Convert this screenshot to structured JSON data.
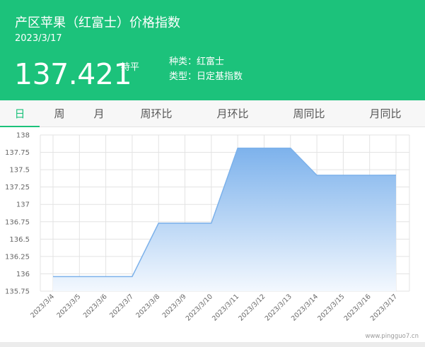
{
  "header": {
    "title": "产区苹果（红富士）价格指数",
    "date": "2023/3/17",
    "price": "137.421",
    "trend": "持平",
    "variety": "种类：红富士",
    "type": "类型：日定基指数"
  },
  "tabs": [
    {
      "label": "日",
      "active": true
    },
    {
      "label": "周",
      "active": false
    },
    {
      "label": "月",
      "active": false
    },
    {
      "label": "周环比",
      "active": false
    },
    {
      "label": "月环比",
      "active": false
    },
    {
      "label": "周同比",
      "active": false
    },
    {
      "label": "月同比",
      "active": false
    }
  ],
  "chart_data": {
    "type": "area",
    "categories": [
      "2023/3/4",
      "2023/3/5",
      "2023/3/6",
      "2023/3/7",
      "2023/3/8",
      "2023/3/9",
      "2023/3/10",
      "2023/3/11",
      "2023/3/12",
      "2023/3/13",
      "2023/3/14",
      "2023/3/15",
      "2023/3/16",
      "2023/3/17"
    ],
    "values": [
      135.96,
      135.96,
      135.96,
      135.96,
      136.73,
      136.73,
      136.73,
      137.81,
      137.81,
      137.81,
      137.42,
      137.42,
      137.42,
      137.421
    ],
    "yticks": [
      "138",
      "137.75",
      "137.5",
      "137.25",
      "137",
      "136.75",
      "136.5",
      "136.25",
      "136",
      "135.75"
    ],
    "ylim": [
      135.75,
      138
    ],
    "grid": true,
    "colors": {
      "line": "#7cb1ea",
      "fill_top": "#7db2ec",
      "fill_bottom": "#f3f8fe",
      "grid": "#e3e3e3"
    }
  },
  "watermark": "www.pingguo7.cn"
}
